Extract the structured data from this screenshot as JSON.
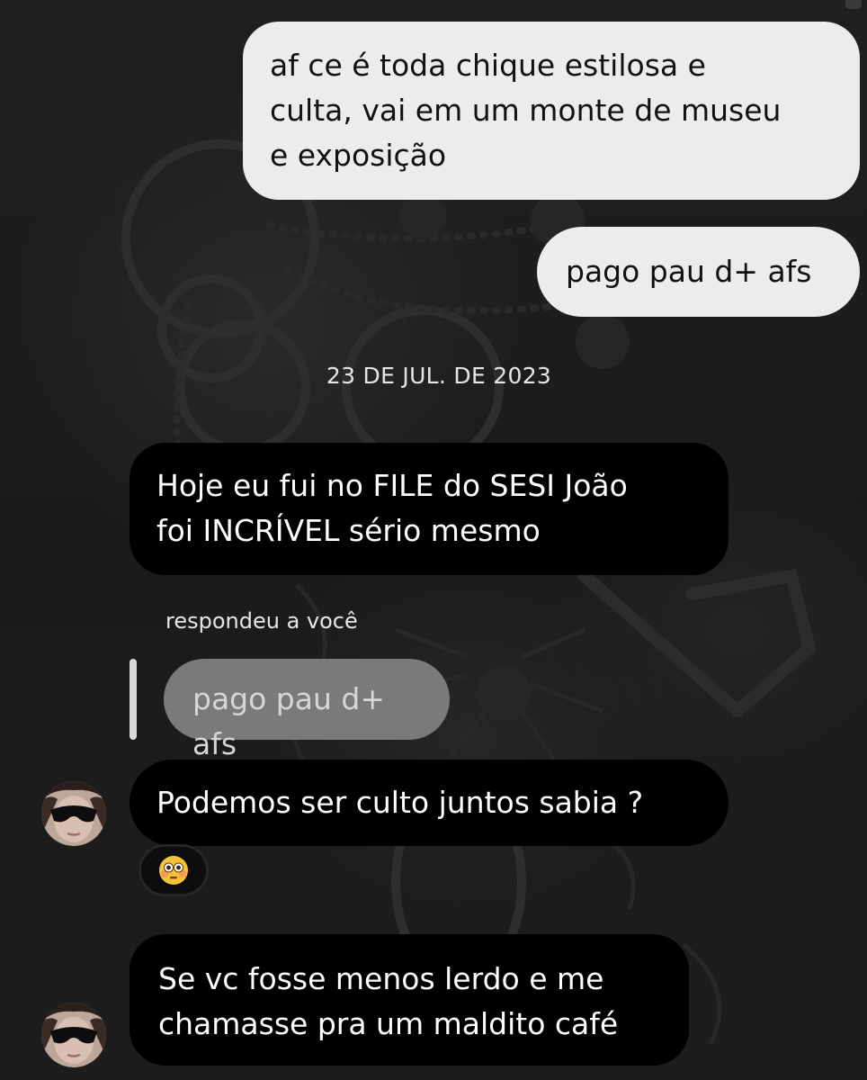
{
  "messages": {
    "sent_1": {
      "line1": "af ce é toda chique estilosa e",
      "line2": "culta, vai em um monte de museu",
      "line3": "e exposição"
    },
    "sent_2": "pago pau d+ afs",
    "date_separator": "23 DE JUL. DE 2023",
    "received_1": {
      "line1": "Hoje eu fui no FILE do SESI João",
      "line2": "foi INCRÍVEL sério mesmo"
    },
    "reply_header": "respondeu a você",
    "reply_quote": "pago pau d+ afs",
    "received_2": "Podemos ser culto juntos sabia ?",
    "reaction_emoji": "😳",
    "received_3": {
      "line1": "Se vc fosse menos lerdo e me",
      "line2": "chamasse pra um maldito café"
    }
  },
  "icons": {
    "avatar": "avatar-sunglasses-person",
    "reaction": "flushed-face-emoji"
  },
  "colors": {
    "background": "#1c1c1c",
    "sent_bubble": "#ececec",
    "received_bubble": "#000000",
    "reply_quote_bubble": "#7a7a7a",
    "text_light": "#ffffff",
    "text_dark": "#111111"
  }
}
